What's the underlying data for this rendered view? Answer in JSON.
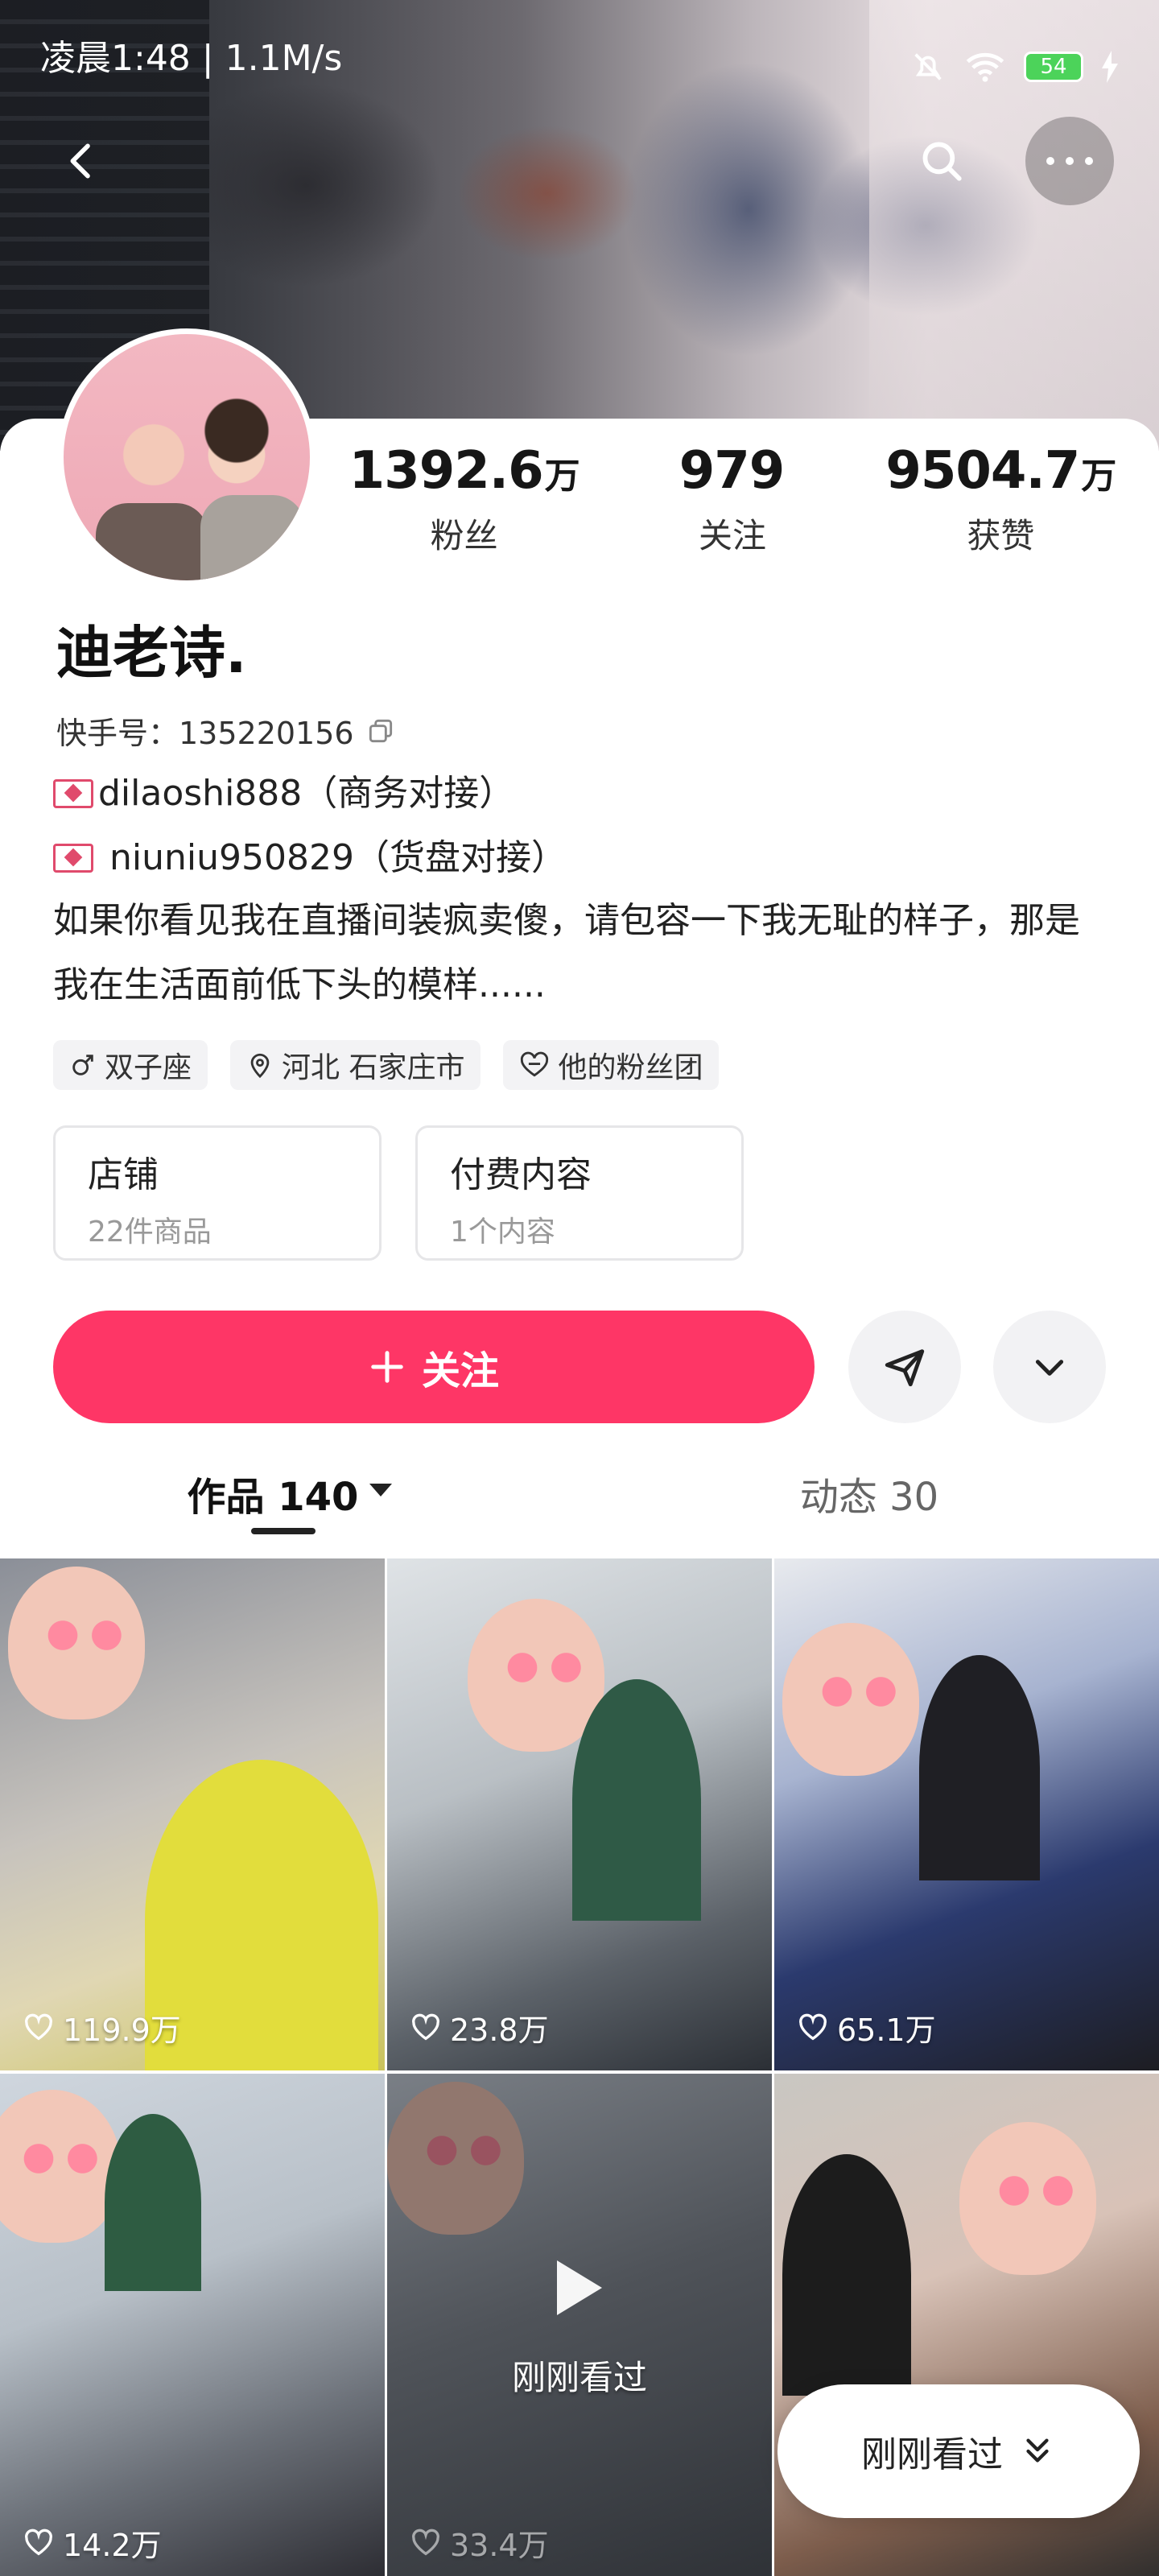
{
  "status_bar": {
    "time_speed": "凌晨1:48 | 1.1M/s",
    "battery": "54"
  },
  "profile": {
    "stats": [
      {
        "value": "1392.6",
        "unit": "万",
        "label": "粉丝"
      },
      {
        "value": "979",
        "unit": "",
        "label": "关注"
      },
      {
        "value": "9504.7",
        "unit": "万",
        "label": "获赞"
      }
    ],
    "name": "迪老诗.",
    "kuaishou_id": "快手号：135220156",
    "bio_line1": "dilaoshi888（商务对接）",
    "bio_line2": " niuniu950829（货盘对接）",
    "bio_text": "如果你看见我在直播间装疯卖傻，请包容一下我无耻的样子，那是我在生活面前低下头的模样......",
    "tags": [
      "双子座",
      "河北 石家庄市",
      "他的粉丝团"
    ]
  },
  "boxes": [
    {
      "title": "店铺",
      "sub": "22件商品"
    },
    {
      "title": "付费内容",
      "sub": "1个内容"
    }
  ],
  "actions": {
    "follow_label": "关注"
  },
  "tabs": [
    {
      "label": "作品 140",
      "active": true
    },
    {
      "label": "动态 30",
      "active": false
    }
  ],
  "videos": [
    {
      "likes": "119.9万"
    },
    {
      "likes": "23.8万"
    },
    {
      "likes": "65.1万"
    },
    {
      "likes": "14.2万"
    },
    {
      "likes": "33.4万",
      "overlay": "刚刚看过"
    },
    {
      "likes": ""
    }
  ],
  "floating": {
    "label": "刚刚看过"
  },
  "colors": {
    "accent": "#fe3666",
    "tag_bg": "#f3f3f5"
  }
}
